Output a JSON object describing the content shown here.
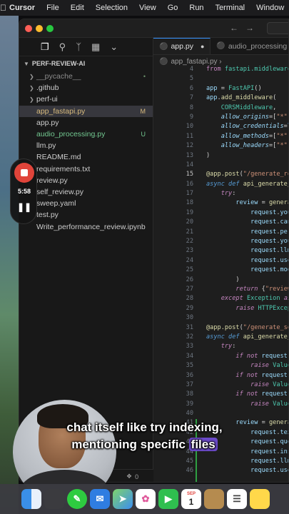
{
  "menubar": {
    "app": "Cursor",
    "items": [
      "File",
      "Edit",
      "Selection",
      "View",
      "Go",
      "Run",
      "Terminal",
      "Window"
    ]
  },
  "sidebar": {
    "project": "PERF-REVIEW-AI",
    "items": [
      {
        "name": "__pycache__",
        "type": "folder",
        "badge": "•"
      },
      {
        "name": ".github",
        "type": "folder",
        "badge": ""
      },
      {
        "name": "perf-ui",
        "type": "folder",
        "badge": ""
      },
      {
        "name": "app_fastapi.py",
        "type": "file",
        "badge": "M"
      },
      {
        "name": "app.py",
        "type": "file",
        "badge": ""
      },
      {
        "name": "audio_processing.py",
        "type": "file",
        "badge": "U"
      },
      {
        "name": "llm.py",
        "type": "file",
        "badge": ""
      },
      {
        "name": "README.md",
        "type": "file",
        "badge": ""
      },
      {
        "name": "requirements.txt",
        "type": "file",
        "badge": ""
      },
      {
        "name": "review.py",
        "type": "file",
        "badge": ""
      },
      {
        "name": "self_review.py",
        "type": "file",
        "badge": ""
      },
      {
        "name": "sweep.yaml",
        "type": "file",
        "badge": ""
      },
      {
        "name": "test.py",
        "type": "file",
        "badge": ""
      },
      {
        "name": "Write_performance_review.ipynb",
        "type": "file",
        "badge": ""
      }
    ],
    "status": "0"
  },
  "editor": {
    "tabs": [
      {
        "label": "app.py",
        "modified": true
      },
      {
        "label": "audio_processing",
        "modified": false
      }
    ],
    "breadcrumb": "app_fastapi.py",
    "current_line": "15"
  },
  "recording": {
    "time": "5:58"
  },
  "caption": {
    "line1": "chat itself like try indexing,",
    "line2_prefix": "mentioning specific",
    "line2_highlight": "files"
  },
  "dock": {
    "calendar_month": "SEP",
    "calendar_day": "1"
  }
}
